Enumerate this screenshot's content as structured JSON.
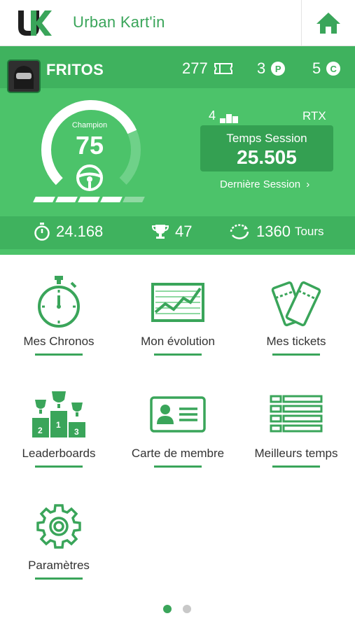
{
  "header": {
    "app_title": "Urban Kart'in",
    "logo_letters": "UK"
  },
  "player": {
    "name": "FRITOS",
    "tickets": "277",
    "points": "3",
    "credits": "5",
    "points_badge": "P",
    "credits_badge": "C",
    "level_label": "Champion",
    "level_value": "75",
    "level_progress_bars": 5,
    "level_progress_filled": 4,
    "rank": "4",
    "kart": "RTX",
    "session_label": "Temps Session",
    "session_time": "25.505",
    "last_session_link": "Dernière Session",
    "best_time": "24.168",
    "trophies": "47",
    "laps": "1360",
    "laps_unit": "Tours"
  },
  "menu": [
    {
      "label": "Mes Chronos",
      "icon": "stopwatch-icon"
    },
    {
      "label": "Mon évolution",
      "icon": "evolution-chart-icon"
    },
    {
      "label": "Mes tickets",
      "icon": "tickets-icon"
    },
    {
      "label": "Leaderboards",
      "icon": "podium-icon"
    },
    {
      "label": "Carte de membre",
      "icon": "member-card-icon"
    },
    {
      "label": "Meilleurs temps",
      "icon": "list-icon"
    },
    {
      "label": "Paramètres",
      "icon": "gear-icon"
    }
  ],
  "pager": {
    "pages": 2,
    "current": 1
  },
  "colors": {
    "accent": "#3aa55a",
    "panel": "#4cc36a",
    "panel_dark": "#3fb25e"
  }
}
